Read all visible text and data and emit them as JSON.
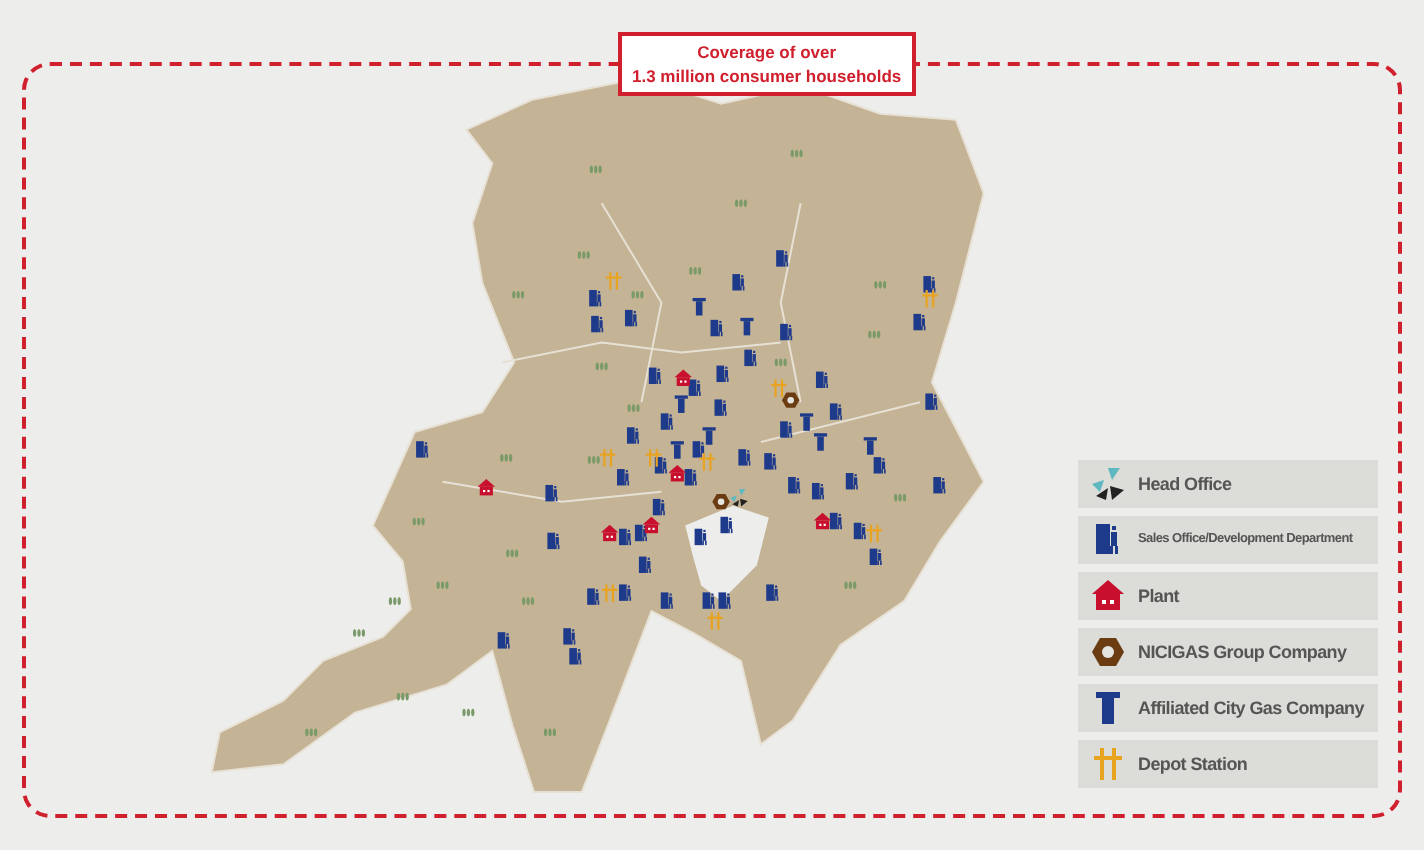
{
  "coverage_note": {
    "lines": [
      "Coverage of over",
      "1.3 million consumer households"
    ]
  },
  "legend": [
    {
      "kind": "head_office",
      "label": "Head Office"
    },
    {
      "kind": "sales_office",
      "label": "Sales Office/Development Department"
    },
    {
      "kind": "plant",
      "label": "Plant"
    },
    {
      "kind": "group_company",
      "label": "NICIGAS Group Company"
    },
    {
      "kind": "city_gas",
      "label": "Affiliated City Gas Company"
    },
    {
      "kind": "depot",
      "label": "Depot Station"
    }
  ]
}
